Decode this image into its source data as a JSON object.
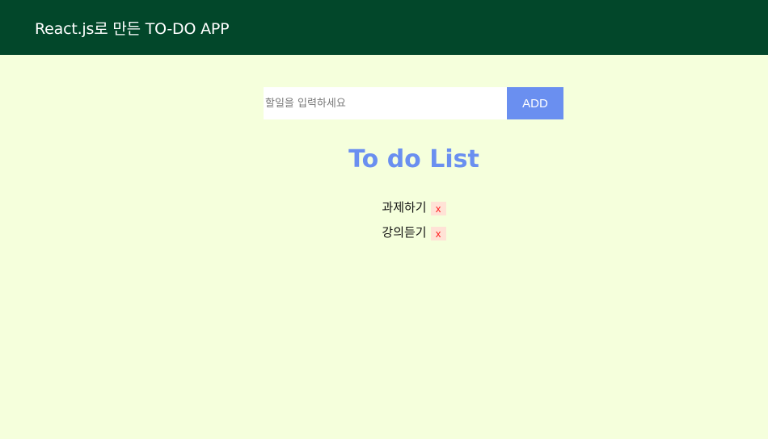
{
  "header": {
    "title": "React.js로 만든 TO-DO APP"
  },
  "form": {
    "input_placeholder": "할일을 입력하세요",
    "input_value": "",
    "add_label": "ADD"
  },
  "list": {
    "title": "To do List",
    "items": [
      {
        "text": "과제하기",
        "delete_label": "x"
      },
      {
        "text": "강의듣기",
        "delete_label": "x"
      }
    ]
  },
  "colors": {
    "header_bg": "#02472a",
    "page_bg": "#f5ffdc",
    "accent": "#6a8ff0",
    "delete_bg": "#ffe2d6",
    "delete_fg": "#ff1a1a"
  }
}
